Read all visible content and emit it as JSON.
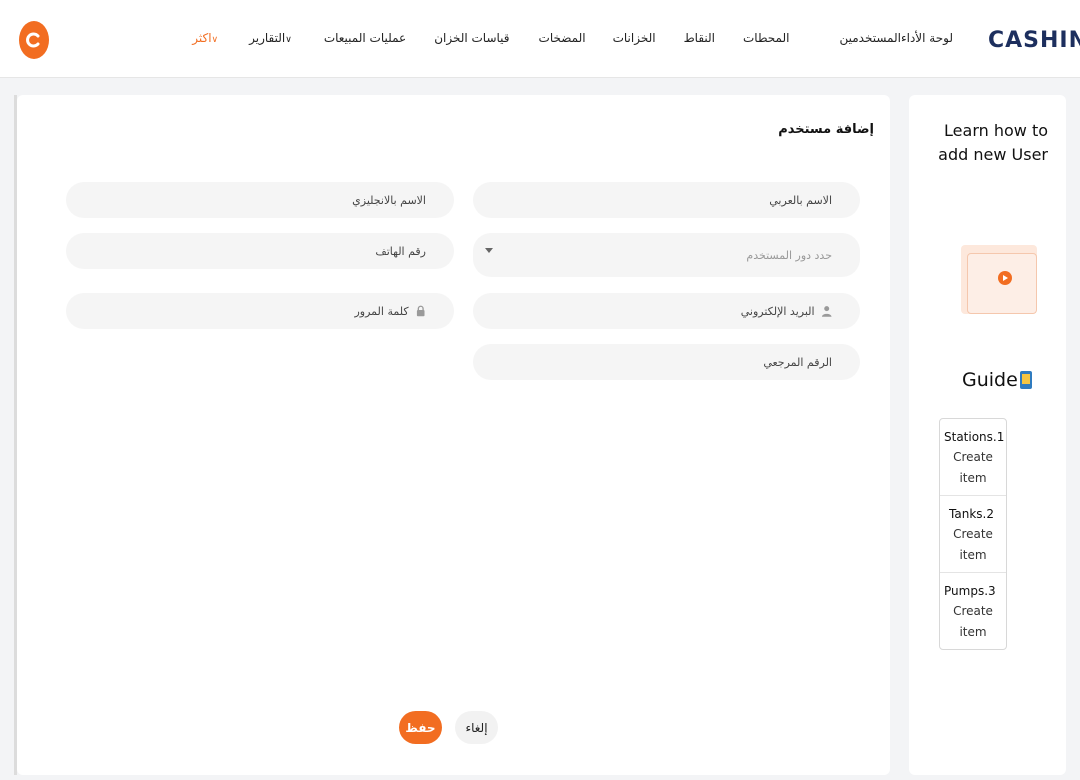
{
  "brand": {
    "logo": "CASHIN",
    "accent": "#f26d21",
    "logo_color": "#1d2f5e"
  },
  "nav": {
    "items": [
      "لوحة الأداء",
      "المستخدمين",
      "المحطات",
      "النقاط",
      "الخزانات",
      "المضخات",
      "قياسات الخزان",
      "عمليات المبيعات",
      "التقارير",
      "اكثر"
    ]
  },
  "form": {
    "title": "إضافة مستخدم",
    "fields": {
      "name_ar": "الاسم بالعربي",
      "name_en": "الاسم بالانجليزي",
      "role_placeholder": "حدد دور المستخدم",
      "phone": "رقم الهاتف",
      "email": "البريد الإلكتروني",
      "password": "كلمة المرور",
      "reference": "الرقم المرجعي"
    },
    "save_label": "حفظ",
    "cancel_label": "إلغاء"
  },
  "guide": {
    "learn_title": "Learn how to add new User",
    "heading": "Guide",
    "steps": [
      {
        "title": "Stations.1",
        "sub": "Create item"
      },
      {
        "title": "Tanks.2",
        "sub": "Create item"
      },
      {
        "title": "Pumps.3",
        "sub": "Create item"
      }
    ]
  }
}
